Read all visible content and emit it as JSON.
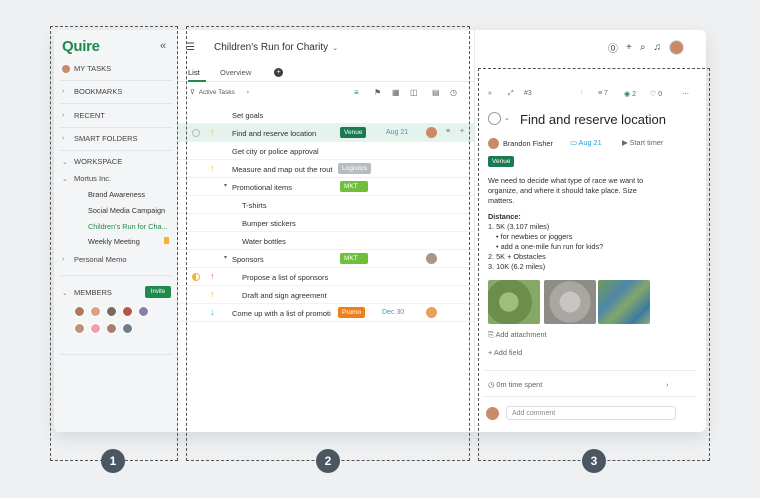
{
  "sidebar": {
    "logo": "Quire",
    "collapse_icon": "«",
    "my_tasks": "MY TASKS",
    "bookmarks": "BOOKMARKS",
    "recent": "RECENT",
    "smart_folders": "SMART FOLDERS",
    "workspace": "WORKSPACE",
    "org": "Mortus Inc.",
    "projects": [
      "Brand Awareness",
      "Social Media Campaign",
      "Children's Run for Cha...",
      "Weekly Meeting"
    ],
    "personal": "Personal Memo",
    "members": "MEMBERS",
    "invite": "Invite"
  },
  "main": {
    "project_title": "Children's Run for Charity",
    "tabs": [
      "List",
      "Overview"
    ],
    "filter": "Active Tasks",
    "tasks": [
      {
        "name": "Set goals"
      },
      {
        "name": "Find and reserve location",
        "tag": "Venue",
        "date": "Aug 21"
      },
      {
        "name": "Get city or police approval"
      },
      {
        "name": "Measure and map out the rout",
        "tag": "Logistics"
      },
      {
        "name": "Promotional items",
        "tag": "MKT"
      },
      {
        "name": "T-shirts"
      },
      {
        "name": "Bumper stickers"
      },
      {
        "name": "Water bottles"
      },
      {
        "name": "Sponsors",
        "tag": "MKT"
      },
      {
        "name": "Propose a list of sponsors"
      },
      {
        "name": "Draft and sign agreement"
      },
      {
        "name": "Come up with a list of promoti",
        "tag": "Promo",
        "date": "Dec 30"
      }
    ]
  },
  "detail": {
    "id": "#3",
    "counts": [
      "7",
      "2",
      "0"
    ],
    "title": "Find and reserve location",
    "assignee": "Brandon Fisher",
    "due": "Aug 21",
    "start_timer": "Start timer",
    "tag": "Venue",
    "description": [
      "We need to decide what type of race we want to",
      "organize, and where it should take place. Size",
      "matters."
    ],
    "distance_label": "Distance:",
    "distance_lines": [
      "1. 5K (3.107 miles)",
      "• for newbies or joggers",
      "• add a one-mile fun run for kids?",
      "2. 5K + Obstacles",
      "3. 10K (6.2 miles)"
    ],
    "add_attachment": "Add attachment",
    "add_field": "Add field",
    "time_spent": "0m time spent",
    "comment_placeholder": "Add comment"
  },
  "callouts": [
    "1",
    "2",
    "3"
  ],
  "colors": {
    "brand": "#1f8a4c",
    "date": "#2d9fd8",
    "logistics": "#b8bcc0",
    "promo": "#f07f1a"
  }
}
